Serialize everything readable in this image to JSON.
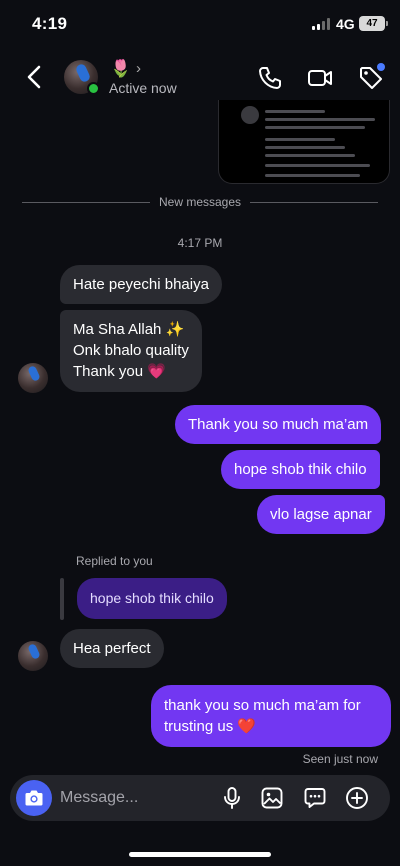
{
  "status_bar": {
    "time": "4:19",
    "network": "4G",
    "battery": "47"
  },
  "header": {
    "name_emoji": "🌷",
    "chevron": "›",
    "status": "Active now",
    "icons": [
      "back-icon",
      "phone-icon",
      "video-camera-icon",
      "tag-icon"
    ]
  },
  "conversation": {
    "divider_label": "New messages",
    "timestamp": "4:17 PM",
    "incoming_1": {
      "line1": "Hate peyechi bhaiya"
    },
    "incoming_2": {
      "line1": "Ma Sha Allah ✨",
      "line2": "Onk bhalo quality",
      "line3": "Thank you 💗"
    },
    "outgoing_1": "Thank you so much ma’am",
    "outgoing_2": "hope shob thik chilo",
    "outgoing_3": "vlo lagse apnar",
    "replied_label": "Replied to you",
    "reply_quote": "hope shob thik chilo",
    "incoming_3": "Hea perfect",
    "outgoing_4": {
      "line1": "thank you so much ma’am for",
      "line2": "trusting us ❤️"
    },
    "seen": "Seen just now"
  },
  "composer": {
    "placeholder": "Message...",
    "icons": [
      "camera-icon",
      "microphone-icon",
      "image-icon",
      "sticker-icon",
      "add-icon"
    ]
  },
  "colors": {
    "background": "#0c0d12",
    "incoming_bubble": "#2a2b31",
    "outgoing_bubble": "#7237f2",
    "reply_quote_bubble": "#3b1e86",
    "online": "#29c241",
    "camera_button": "#4a62f2"
  }
}
